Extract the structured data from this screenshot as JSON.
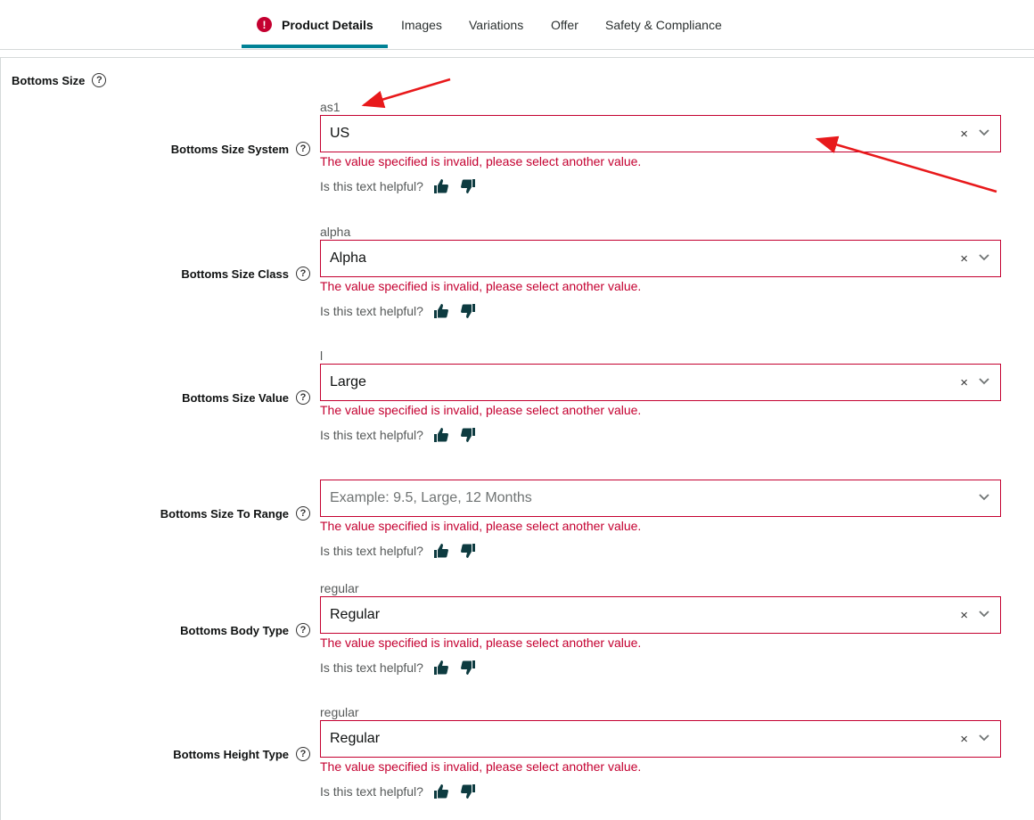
{
  "tabs": [
    {
      "label": "Product Details",
      "has_error": true,
      "active": true
    },
    {
      "label": "Images"
    },
    {
      "label": "Variations"
    },
    {
      "label": "Offer"
    },
    {
      "label": "Safety & Compliance"
    }
  ],
  "section": {
    "title": "Bottoms Size",
    "help_icon": "?"
  },
  "error_icon": "!",
  "clear_glyph": "×",
  "helpful_text": "Is this text helpful?",
  "error_message": "The value specified is invalid, please select another value.",
  "fields": [
    {
      "label": "Bottoms Size System",
      "suggestion": "as1",
      "value": "US"
    },
    {
      "label": "Bottoms Size Class",
      "suggestion": "alpha",
      "value": "Alpha"
    },
    {
      "label": "Bottoms Size Value",
      "suggestion": "l",
      "value": "Large"
    },
    {
      "label": "Bottoms Size To Range",
      "suggestion": "",
      "value": "",
      "placeholder": "Example: 9.5, Large, 12 Months"
    },
    {
      "label": "Bottoms Body Type",
      "suggestion": "regular",
      "value": "Regular"
    },
    {
      "label": "Bottoms Height Type",
      "suggestion": "regular",
      "value": "Regular"
    }
  ],
  "colors": {
    "accent": "#008296",
    "error": "#c40030",
    "annotation": "#e8191b",
    "icon_dark": "#0d3b40"
  }
}
